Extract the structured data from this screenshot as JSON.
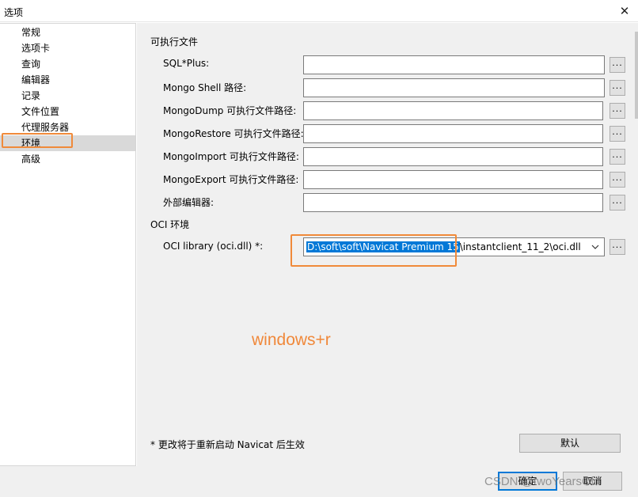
{
  "window": {
    "title": "选项",
    "close_glyph": "✕"
  },
  "sidebar": {
    "items": [
      {
        "label": "常规"
      },
      {
        "label": "选项卡"
      },
      {
        "label": "查询"
      },
      {
        "label": "编辑器"
      },
      {
        "label": "记录"
      },
      {
        "label": "文件位置"
      },
      {
        "label": "代理服务器"
      },
      {
        "label": "环境",
        "selected": true
      },
      {
        "label": "高级"
      }
    ]
  },
  "executables": {
    "section_title": "可执行文件",
    "browse_label": "...",
    "fields": [
      {
        "label": "SQL*Plus:",
        "value": ""
      },
      {
        "label": "Mongo Shell 路径:",
        "value": ""
      },
      {
        "label": "MongoDump 可执行文件路径:",
        "value": ""
      },
      {
        "label": "MongoRestore 可执行文件路径:",
        "value": ""
      },
      {
        "label": "MongoImport 可执行文件路径:",
        "value": ""
      },
      {
        "label": "MongoExport 可执行文件路径:",
        "value": ""
      },
      {
        "label": "外部编辑器:",
        "value": ""
      }
    ]
  },
  "oci": {
    "section_title": "OCI 环境",
    "label": "OCI library (oci.dll) *:",
    "value_selected": "D:\\soft\\soft\\Navicat Premium 15",
    "value_rest": "\\instantclient_11_2\\oci.dll",
    "browse_label": "..."
  },
  "annotation": "windows+r",
  "note": "* 更改将于重新启动 Navicat 后生效",
  "buttons": {
    "default": "默认",
    "ok": "确定",
    "cancel": "取消"
  },
  "watermark": "CSDN @twoYearsOld",
  "colors": {
    "accent": "#0078d7",
    "annotation": "#f0883a",
    "selection": "#d9d9d9"
  }
}
